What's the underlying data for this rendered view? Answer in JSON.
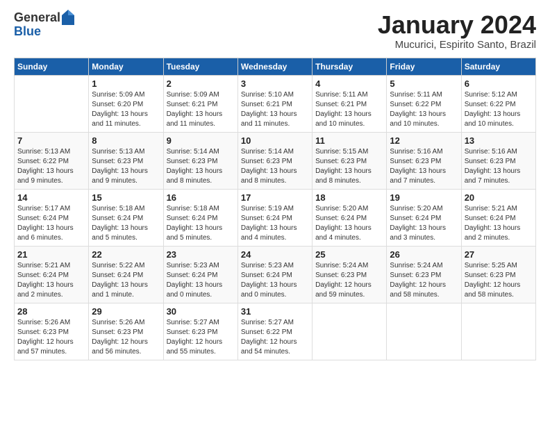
{
  "logo": {
    "general": "General",
    "blue": "Blue"
  },
  "header": {
    "month_title": "January 2024",
    "location": "Mucurici, Espirito Santo, Brazil"
  },
  "days_of_week": [
    "Sunday",
    "Monday",
    "Tuesday",
    "Wednesday",
    "Thursday",
    "Friday",
    "Saturday"
  ],
  "weeks": [
    [
      {
        "num": "",
        "info": ""
      },
      {
        "num": "1",
        "info": "Sunrise: 5:09 AM\nSunset: 6:20 PM\nDaylight: 13 hours\nand 11 minutes."
      },
      {
        "num": "2",
        "info": "Sunrise: 5:09 AM\nSunset: 6:21 PM\nDaylight: 13 hours\nand 11 minutes."
      },
      {
        "num": "3",
        "info": "Sunrise: 5:10 AM\nSunset: 6:21 PM\nDaylight: 13 hours\nand 11 minutes."
      },
      {
        "num": "4",
        "info": "Sunrise: 5:11 AM\nSunset: 6:21 PM\nDaylight: 13 hours\nand 10 minutes."
      },
      {
        "num": "5",
        "info": "Sunrise: 5:11 AM\nSunset: 6:22 PM\nDaylight: 13 hours\nand 10 minutes."
      },
      {
        "num": "6",
        "info": "Sunrise: 5:12 AM\nSunset: 6:22 PM\nDaylight: 13 hours\nand 10 minutes."
      }
    ],
    [
      {
        "num": "7",
        "info": "Sunrise: 5:13 AM\nSunset: 6:22 PM\nDaylight: 13 hours\nand 9 minutes."
      },
      {
        "num": "8",
        "info": "Sunrise: 5:13 AM\nSunset: 6:23 PM\nDaylight: 13 hours\nand 9 minutes."
      },
      {
        "num": "9",
        "info": "Sunrise: 5:14 AM\nSunset: 6:23 PM\nDaylight: 13 hours\nand 8 minutes."
      },
      {
        "num": "10",
        "info": "Sunrise: 5:14 AM\nSunset: 6:23 PM\nDaylight: 13 hours\nand 8 minutes."
      },
      {
        "num": "11",
        "info": "Sunrise: 5:15 AM\nSunset: 6:23 PM\nDaylight: 13 hours\nand 8 minutes."
      },
      {
        "num": "12",
        "info": "Sunrise: 5:16 AM\nSunset: 6:23 PM\nDaylight: 13 hours\nand 7 minutes."
      },
      {
        "num": "13",
        "info": "Sunrise: 5:16 AM\nSunset: 6:23 PM\nDaylight: 13 hours\nand 7 minutes."
      }
    ],
    [
      {
        "num": "14",
        "info": "Sunrise: 5:17 AM\nSunset: 6:24 PM\nDaylight: 13 hours\nand 6 minutes."
      },
      {
        "num": "15",
        "info": "Sunrise: 5:18 AM\nSunset: 6:24 PM\nDaylight: 13 hours\nand 5 minutes."
      },
      {
        "num": "16",
        "info": "Sunrise: 5:18 AM\nSunset: 6:24 PM\nDaylight: 13 hours\nand 5 minutes."
      },
      {
        "num": "17",
        "info": "Sunrise: 5:19 AM\nSunset: 6:24 PM\nDaylight: 13 hours\nand 4 minutes."
      },
      {
        "num": "18",
        "info": "Sunrise: 5:20 AM\nSunset: 6:24 PM\nDaylight: 13 hours\nand 4 minutes."
      },
      {
        "num": "19",
        "info": "Sunrise: 5:20 AM\nSunset: 6:24 PM\nDaylight: 13 hours\nand 3 minutes."
      },
      {
        "num": "20",
        "info": "Sunrise: 5:21 AM\nSunset: 6:24 PM\nDaylight: 13 hours\nand 2 minutes."
      }
    ],
    [
      {
        "num": "21",
        "info": "Sunrise: 5:21 AM\nSunset: 6:24 PM\nDaylight: 13 hours\nand 2 minutes."
      },
      {
        "num": "22",
        "info": "Sunrise: 5:22 AM\nSunset: 6:24 PM\nDaylight: 13 hours\nand 1 minute."
      },
      {
        "num": "23",
        "info": "Sunrise: 5:23 AM\nSunset: 6:24 PM\nDaylight: 13 hours\nand 0 minutes."
      },
      {
        "num": "24",
        "info": "Sunrise: 5:23 AM\nSunset: 6:24 PM\nDaylight: 13 hours\nand 0 minutes."
      },
      {
        "num": "25",
        "info": "Sunrise: 5:24 AM\nSunset: 6:23 PM\nDaylight: 12 hours\nand 59 minutes."
      },
      {
        "num": "26",
        "info": "Sunrise: 5:24 AM\nSunset: 6:23 PM\nDaylight: 12 hours\nand 58 minutes."
      },
      {
        "num": "27",
        "info": "Sunrise: 5:25 AM\nSunset: 6:23 PM\nDaylight: 12 hours\nand 58 minutes."
      }
    ],
    [
      {
        "num": "28",
        "info": "Sunrise: 5:26 AM\nSunset: 6:23 PM\nDaylight: 12 hours\nand 57 minutes."
      },
      {
        "num": "29",
        "info": "Sunrise: 5:26 AM\nSunset: 6:23 PM\nDaylight: 12 hours\nand 56 minutes."
      },
      {
        "num": "30",
        "info": "Sunrise: 5:27 AM\nSunset: 6:23 PM\nDaylight: 12 hours\nand 55 minutes."
      },
      {
        "num": "31",
        "info": "Sunrise: 5:27 AM\nSunset: 6:22 PM\nDaylight: 12 hours\nand 54 minutes."
      },
      {
        "num": "",
        "info": ""
      },
      {
        "num": "",
        "info": ""
      },
      {
        "num": "",
        "info": ""
      }
    ]
  ]
}
